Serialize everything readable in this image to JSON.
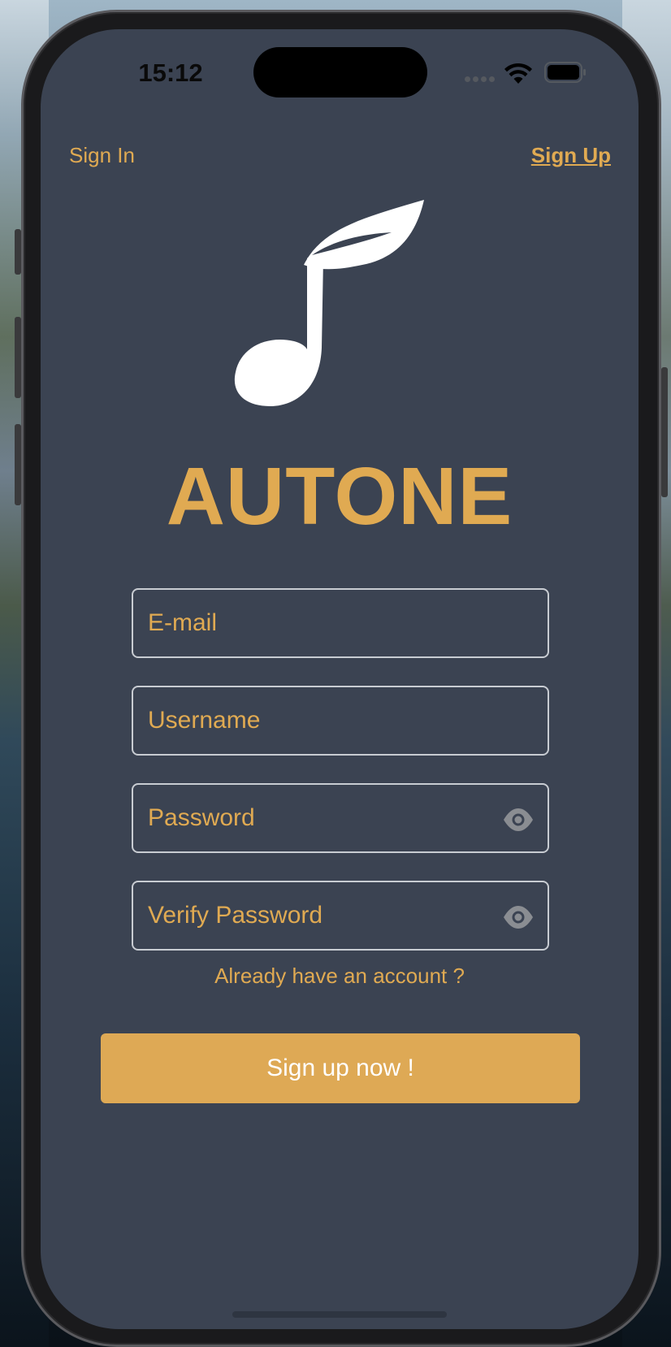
{
  "status_bar": {
    "time": "15:12"
  },
  "nav": {
    "sign_in": "Sign In",
    "sign_up": "Sign Up"
  },
  "app": {
    "title": "AUTONE",
    "logo_icon": "music-note-leaf-icon"
  },
  "form": {
    "email_placeholder": "E-mail",
    "username_placeholder": "Username",
    "password_placeholder": "Password",
    "verify_password_placeholder": "Verify Password"
  },
  "links": {
    "already_account": "Already have an account ?"
  },
  "actions": {
    "signup_button": "Sign up now !"
  },
  "colors": {
    "accent": "#e0aa52",
    "background": "#3b4352",
    "button": "#dea955"
  }
}
